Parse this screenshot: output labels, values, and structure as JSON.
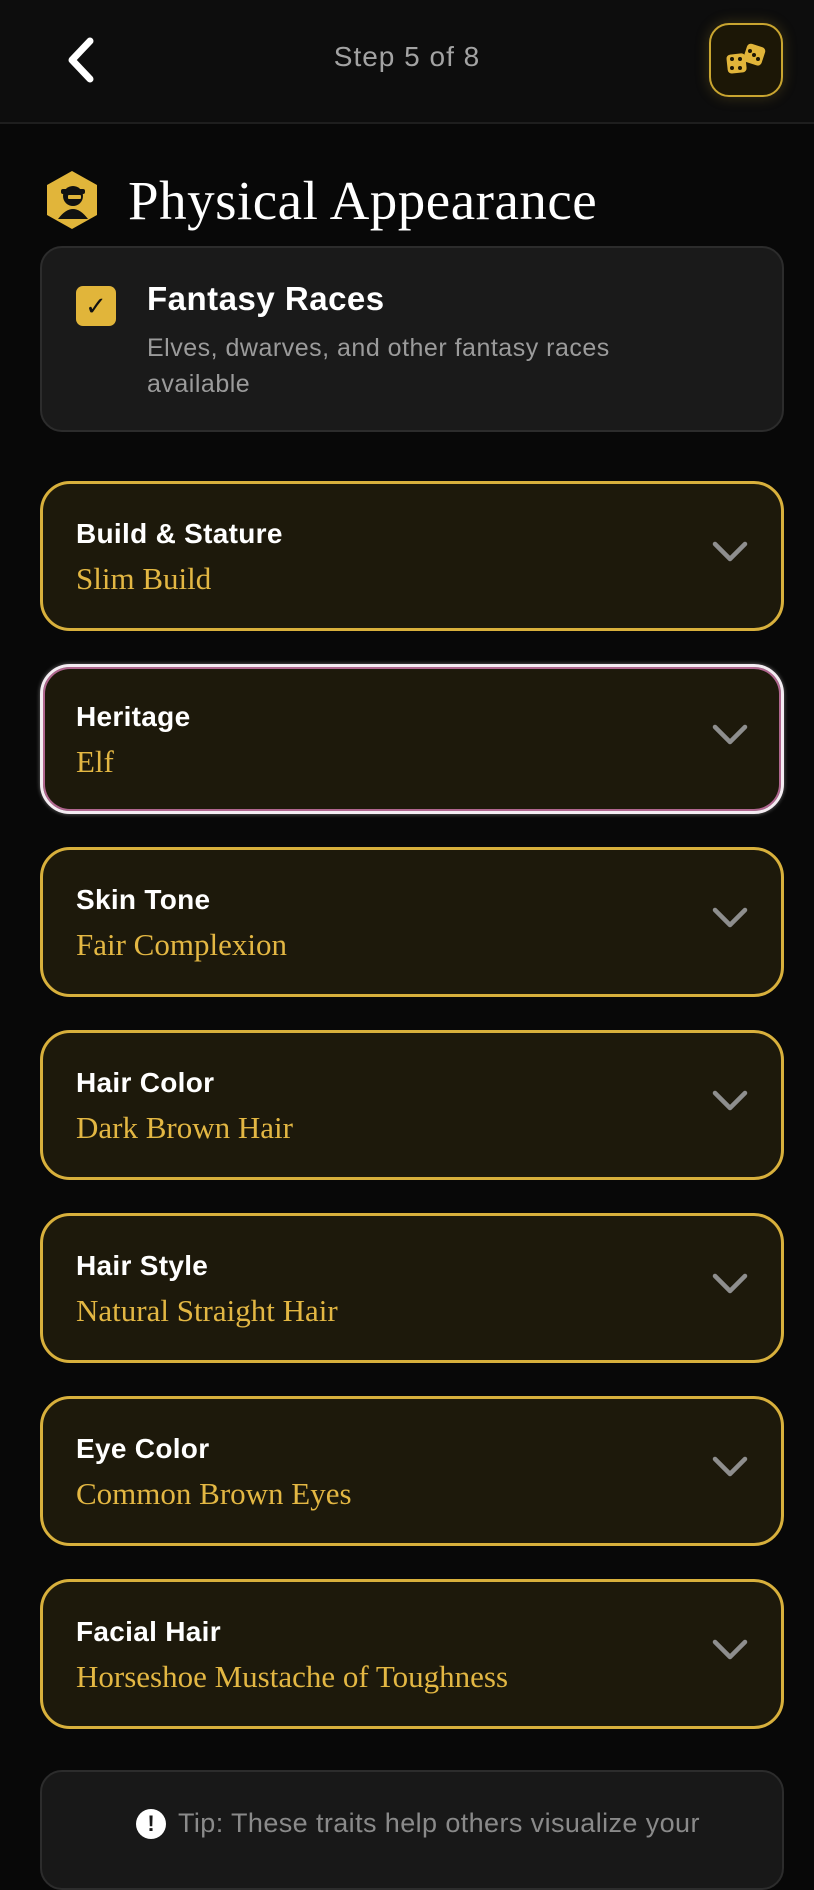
{
  "header": {
    "step_text": "Step 5 of 8",
    "back_icon": "chevron-left-icon",
    "dice_icon": "dice-icon",
    "accent": "#d8b03c"
  },
  "section": {
    "title": "Physical Appearance",
    "icon": "character-hexagon-icon"
  },
  "fantasy_toggle": {
    "checked": true,
    "check_glyph": "✓",
    "title": "Fantasy Races",
    "description": "Elves, dwarves, and other fantasy races available"
  },
  "traits": [
    {
      "label": "Build & Stature",
      "value": "Slim Build"
    },
    {
      "label": "Heritage",
      "value": "Elf"
    },
    {
      "label": "Skin Tone",
      "value": "Fair Complexion"
    },
    {
      "label": "Hair Color",
      "value": "Dark Brown Hair"
    },
    {
      "label": "Hair Style",
      "value": "Natural Straight Hair"
    },
    {
      "label": "Eye Color",
      "value": "Common Brown Eyes"
    },
    {
      "label": "Facial Hair",
      "value": "Horseshoe Mustache of Toughness"
    }
  ],
  "tip": {
    "icon": "info-icon",
    "icon_glyph": "!",
    "text": "Tip: These traits help others visualize your"
  }
}
